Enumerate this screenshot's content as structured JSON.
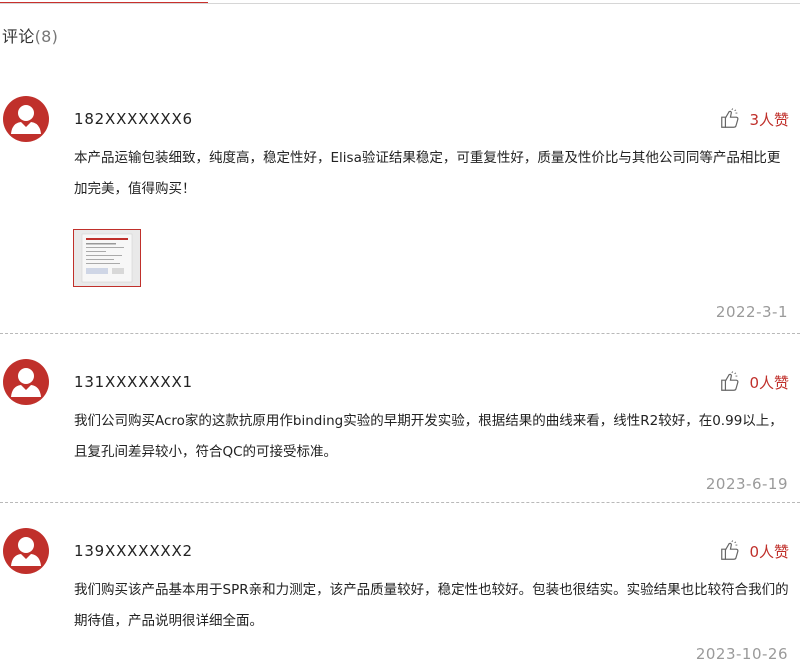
{
  "section": {
    "title": "评论",
    "count": "(8)"
  },
  "comments": [
    {
      "user": "182XXXXXXX6",
      "likes": "3人赞",
      "text": "本产品运输包装细致，纯度高，稳定性好，Elisa验证结果稳定，可重复性好，质量及性价比与其他公司同等产品相比更加完美，值得购买！",
      "date": "2022-3-1",
      "has_image": true
    },
    {
      "user": "131XXXXXXX1",
      "likes": "0人赞",
      "text": "我们公司购买Acro家的这款抗原用作binding实验的早期开发实验，根据结果的曲线来看，线性R2较好，在0.99以上，且复孔间差异较小，符合QC的可接受标准。",
      "date": "2023-6-19",
      "has_image": false
    },
    {
      "user": "139XXXXXXX2",
      "likes": "0人赞",
      "text": "我们购买该产品基本用于SPR亲和力测定，该产品质量较好，稳定性也较好。包装也很结实。实验结果也比较符合我们的期待值，产品说明很详细全面。",
      "date": "2023-10-26",
      "has_image": false
    }
  ],
  "icons": {
    "avatar": "user-avatar-icon",
    "like": "thumbs-up-icon"
  },
  "colors": {
    "accent": "#c0302b",
    "date": "#9a9a9a",
    "divider": "#b9b9b9"
  }
}
